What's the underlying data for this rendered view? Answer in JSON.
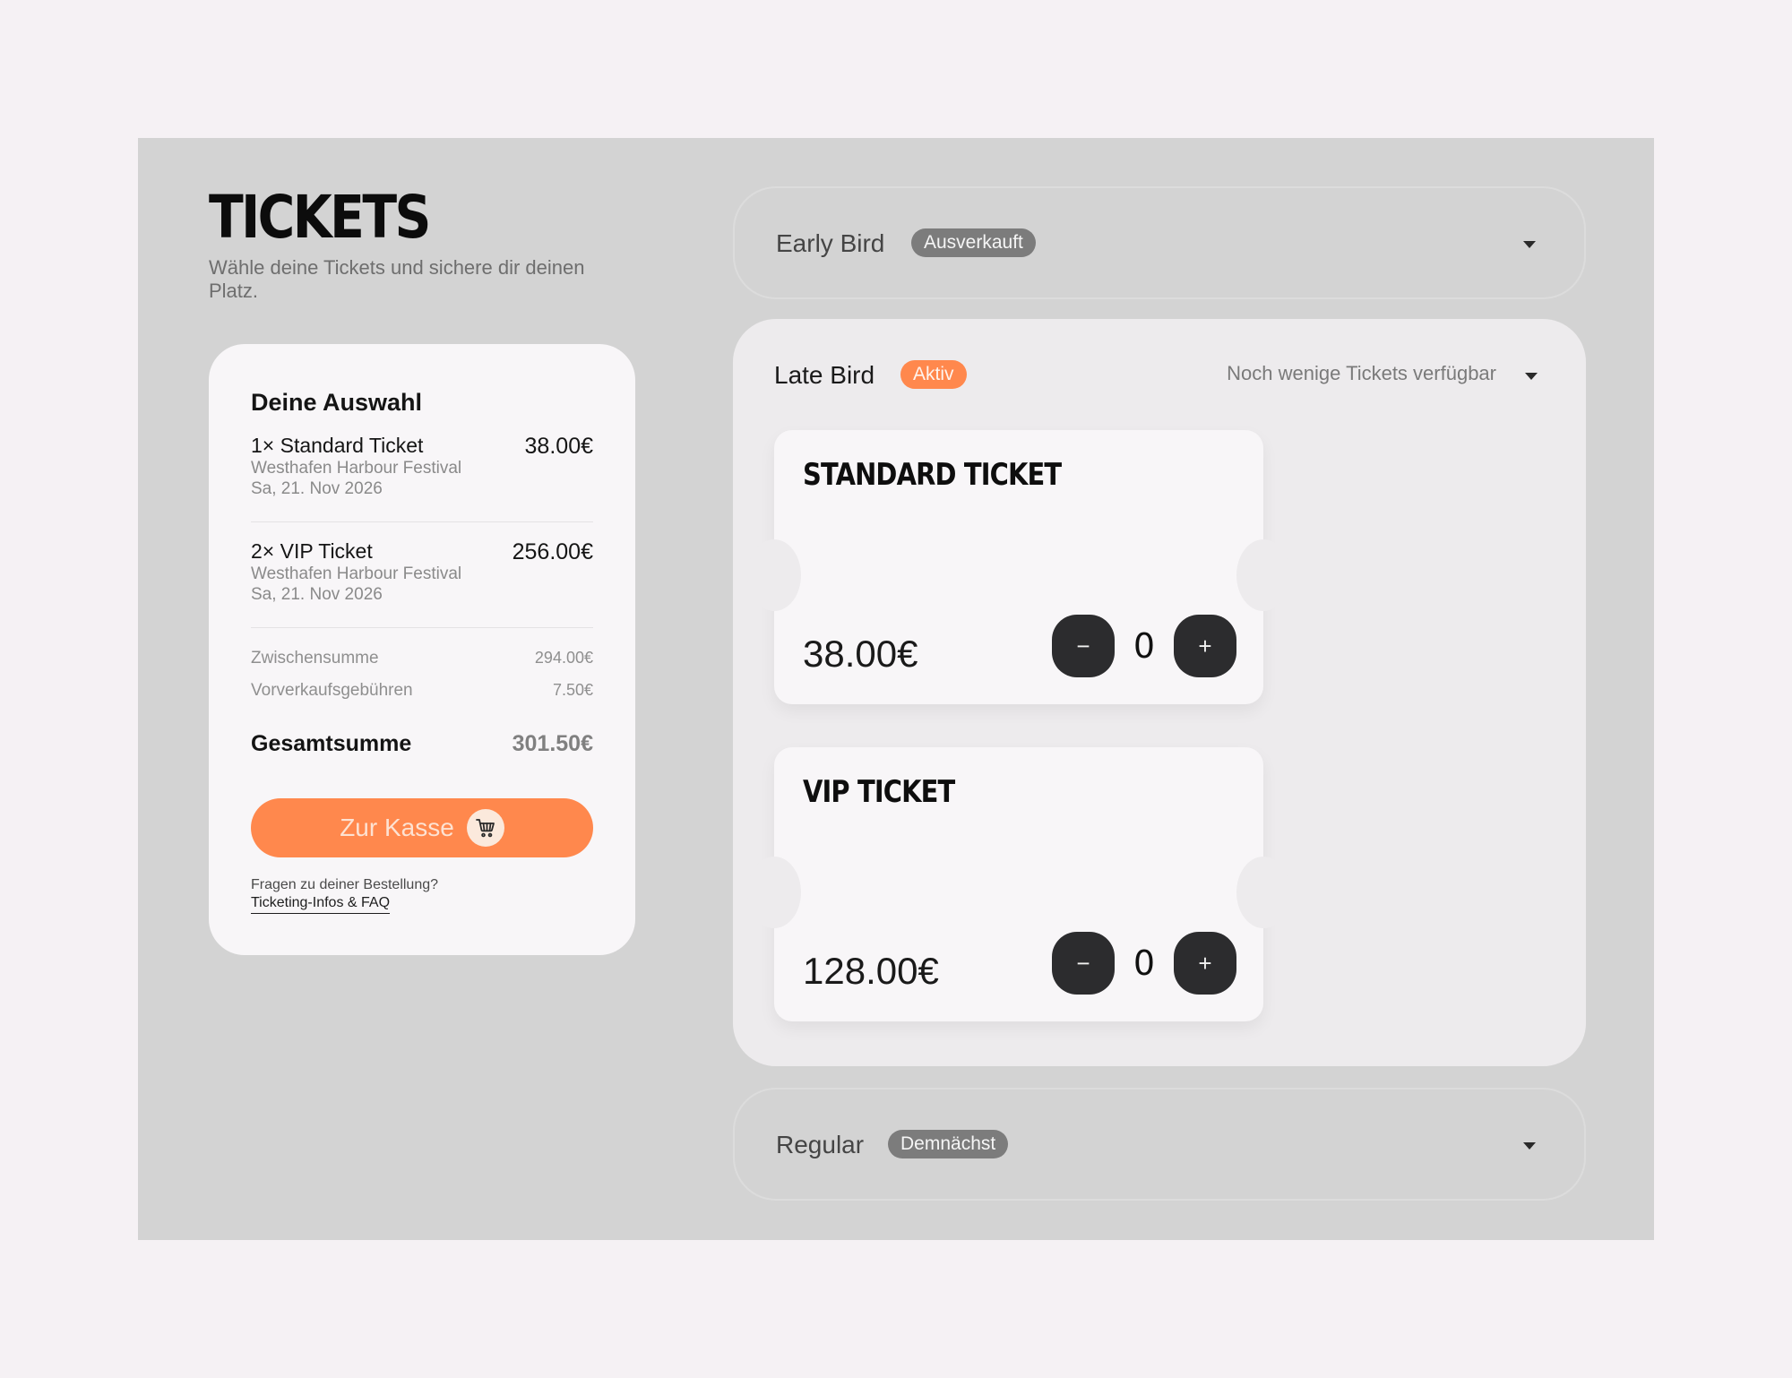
{
  "page": {
    "title": "TICKETS",
    "subtitle": "Wähle deine Tickets und sichere dir deinen Platz."
  },
  "summary": {
    "heading": "Deine Auswahl",
    "items": [
      {
        "name": "1× Standard Ticket",
        "event": "Westhafen Harbour Festival",
        "date": "Sa, 21. Nov 2026",
        "price": "38.00€"
      },
      {
        "name": "2× VIP Ticket",
        "event": "Westhafen Harbour Festival",
        "date": "Sa, 21. Nov 2026",
        "price": "256.00€"
      }
    ],
    "subtotal_label": "Zwischensumme",
    "subtotal_value": "294.00€",
    "fees_label": "Vorverkaufsgebühren",
    "fees_value": "7.50€",
    "total_label": "Gesamtsumme",
    "total_value": "301.50€",
    "checkout_label": "Zur Kasse",
    "faq_question": "Fragen zu deiner Bestellung?",
    "faq_link": "Ticketing-Infos & FAQ"
  },
  "phases": [
    {
      "name": "Early Bird",
      "badge": "Ausverkauft",
      "state": "collapsed"
    },
    {
      "name": "Late Bird",
      "badge": "Aktiv",
      "state": "open",
      "availability": "Noch wenige Tickets verfügbar",
      "tickets": [
        {
          "name": "STANDARD TICKET",
          "price": "38.00€",
          "quantity": "0"
        },
        {
          "name": "VIP TICKET",
          "price": "128.00€",
          "quantity": "0"
        }
      ]
    },
    {
      "name": "Regular",
      "badge": "Demnächst",
      "state": "collapsed"
    }
  ],
  "icons": {
    "cart": "cart-icon",
    "chevron": "chevron-down-icon",
    "minus": "minus-icon",
    "plus": "plus-icon"
  },
  "colors": {
    "accent": "#ff884d",
    "dark_button": "#2c2c2e",
    "panel": "#d3d3d3",
    "background": "#f5f1f4"
  }
}
